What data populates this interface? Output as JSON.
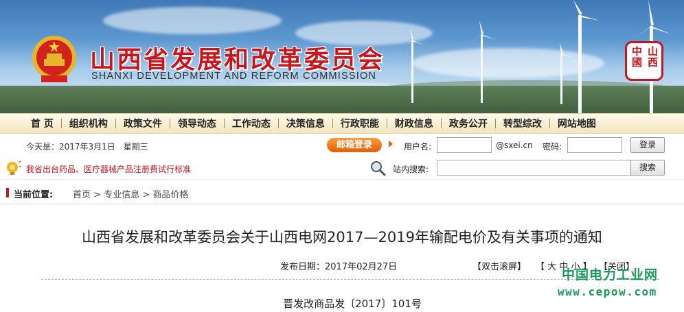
{
  "site": {
    "title_cn": "山西省发展和改革委员会",
    "title_en": "SHANXI DEVELOPMENT AND REFORM COMMISSION",
    "seal_text": "山西中国"
  },
  "nav": {
    "items": [
      "首 页",
      "组织机构",
      "政策文件",
      "领导动态",
      "工作动态",
      "决策信息",
      "行政职能",
      "财政信息",
      "政务公开",
      "转型综改",
      "网站地图"
    ]
  },
  "info_bar": {
    "today": "今天是：2017年3月1日　星期三",
    "mailbox_label": "邮箱登录",
    "username_label": "用户名:",
    "username_value": "",
    "domain": "@sxei.cn",
    "password_label": "密码:",
    "password_value": "",
    "login_button": "登录"
  },
  "notice_bar": {
    "notice_text": "我省出台药品、医疗器械产品注册费试行标准",
    "search_label": "站内搜索:",
    "search_value": "",
    "search_button": "搜索"
  },
  "breadcrumb": {
    "label": "当前位置:",
    "items": [
      "首页",
      "专业信息",
      "商品价格"
    ],
    "separator": ">"
  },
  "article": {
    "title": "山西省发展和改革委员会关于山西电网2017—2019年输配电价及有关事项的通知",
    "publish_date": "发布日期：2017年02月27日",
    "double_click_scroll": "【双击滚屏】",
    "font_size_open": "【",
    "font_large": "大",
    "font_medium": "中",
    "font_small": "小",
    "font_size_close": "】",
    "close_label": "【关闭】",
    "doc_number": "晋发改商品发〔2017〕101号"
  },
  "watermark": {
    "cn": "中国电力工业网",
    "en": "www.cepow.com"
  },
  "colors": {
    "brand_red": "#c8161d",
    "nav_bg": "#f3e5bd",
    "mailbox_orange": "#e0600a",
    "watermark_green": "#1a9a58"
  }
}
